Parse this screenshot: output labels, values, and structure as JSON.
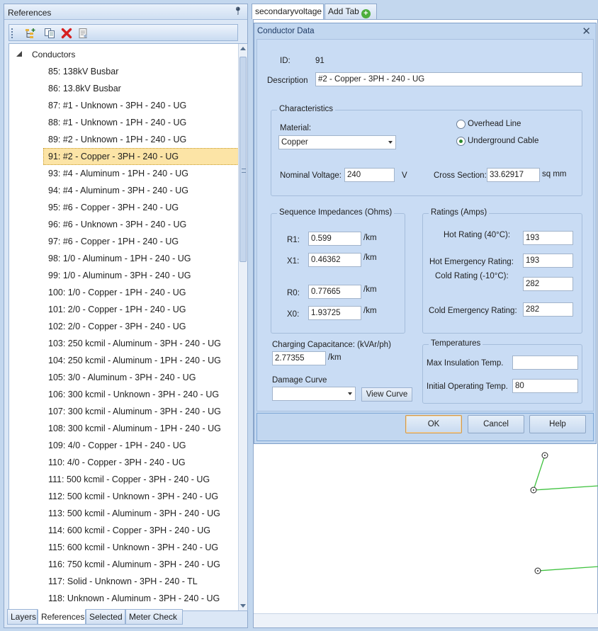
{
  "references_panel": {
    "title": "References",
    "tree": {
      "root_label": "Conductors",
      "items": [
        "85: 138kV Busbar",
        "86: 13.8kV Busbar",
        "87: #1 - Unknown - 3PH - 240 - UG",
        "88: #1 - Unknown - 1PH - 240 - UG",
        "89: #2 - Unknown - 1PH - 240 - UG",
        "91: #2 - Copper - 3PH - 240 - UG",
        "93: #4 - Aluminum - 1PH - 240 - UG",
        "94: #4 - Aluminum - 3PH - 240 - UG",
        "95: #6 - Copper - 3PH - 240 - UG",
        "96: #6 - Unknown - 3PH - 240 - UG",
        "97: #6 - Copper - 1PH - 240 - UG",
        "98: 1/0 - Aluminum - 1PH - 240 - UG",
        "99: 1/0 - Aluminum - 3PH - 240 - UG",
        "100: 1/0 - Copper - 1PH - 240 - UG",
        "101: 2/0 - Copper - 1PH - 240 - UG",
        "102: 2/0 - Copper - 3PH - 240 - UG",
        "103: 250 kcmil - Aluminum - 3PH - 240 - UG",
        "104: 250 kcmil - Aluminum - 1PH - 240 - UG",
        "105: 3/0 - Aluminum - 3PH - 240 - UG",
        "106: 300 kcmil - Unknown - 3PH - 240 - UG",
        "107: 300 kcmil - Aluminum - 3PH - 240 - UG",
        "108: 300 kcmil - Aluminum - 1PH - 240 - UG",
        "109: 4/0 - Copper - 1PH - 240 - UG",
        "110: 4/0 - Copper - 3PH - 240 - UG",
        "111: 500 kcmil - Copper - 3PH - 240 - UG",
        "112: 500 kcmil - Unknown - 3PH - 240 - UG",
        "113: 500 kcmil - Aluminum - 3PH - 240 - UG",
        "114: 600 kcmil - Copper - 3PH - 240 - UG",
        "115: 600 kcmil - Unknown - 3PH - 240 - UG",
        "116: 750 kcmil - Aluminum - 3PH - 240 - UG",
        "117: Solid - Unknown - 3PH - 240 - TL",
        "118: Unknown - Aluminum - 3PH - 240 - UG"
      ],
      "selected_item": "91: #2 - Copper - 3PH - 240 - UG"
    },
    "toolbar_icons": [
      "add-tree-icon",
      "copy-icon",
      "delete-icon",
      "properties-icon"
    ],
    "bottom_tabs": [
      "Layers",
      "References",
      "Selected",
      "Meter Check"
    ],
    "active_tab": "References"
  },
  "document_tabs": {
    "tabs": [
      "secondaryvoltage",
      "Add Tab"
    ],
    "active": "secondaryvoltage"
  },
  "dialog": {
    "title": "Conductor Data",
    "id_label": "ID:",
    "id_value": "91",
    "description_label": "Description",
    "description_value": "#2 - Copper - 3PH - 240 - UG",
    "characteristics": {
      "title": "Characteristics",
      "material_label": "Material:",
      "material_value": "Copper",
      "overhead_label": "Overhead Line",
      "underground_label": "Underground Cable",
      "selected_type": "Underground Cable",
      "nominal_voltage_label": "Nominal Voltage:",
      "nominal_voltage_value": "240",
      "nominal_voltage_unit": "V",
      "cross_section_label": "Cross Section:",
      "cross_section_value": "33.62917",
      "cross_section_unit": "sq mm"
    },
    "sequence": {
      "title": "Sequence Impedances (Ohms)",
      "r1_label": "R1:",
      "r1_value": "0.599",
      "x1_label": "X1:",
      "x1_value": "0.46362",
      "r0_label": "R0:",
      "r0_value": "0.77665",
      "x0_label": "X0:",
      "x0_value": "1.93725",
      "unit": "/km"
    },
    "ratings": {
      "title": "Ratings (Amps)",
      "hot_label": "Hot Rating (40°C):",
      "hot_value": "193",
      "hot_emergency_label": "Hot Emergency Rating:",
      "hot_emergency_value": "193",
      "cold_label": "Cold Rating (-10°C):",
      "cold_value": "282",
      "cold_emergency_label": "Cold Emergency Rating:",
      "cold_emergency_value": "282"
    },
    "charging": {
      "label": "Charging Capacitance: (kVAr/ph)",
      "value": "2.77355",
      "unit": "/km"
    },
    "damage_curve": {
      "label": "Damage Curve",
      "value": "",
      "view_button": "View Curve"
    },
    "temperatures": {
      "title": "Temperatures",
      "max_label": "Max Insulation Temp.",
      "max_value": "",
      "initial_label": "Initial Operating Temp.",
      "initial_value": "80"
    },
    "buttons": {
      "ok": "OK",
      "cancel": "Cancel",
      "help": "Help"
    }
  },
  "colors": {
    "line_green": "#3fc23f",
    "selection": "#fce4a6",
    "panel_bg": "#c3d7ee"
  }
}
